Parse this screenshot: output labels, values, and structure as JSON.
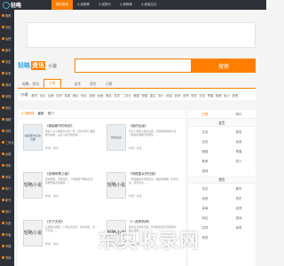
{
  "topbar": {
    "logo_text": "轻略",
    "nav": [
      "就在首页",
      "小说推荐",
      "小说排行",
      "小说榜单",
      "小说诞生记"
    ]
  },
  "sidebar": {
    "items": [
      "推荐",
      "玄幻",
      "仙侠",
      "都市",
      "历史",
      "军事",
      "游戏",
      "体育",
      "科幻",
      "悬疑",
      "灵异",
      "二次元",
      "女频",
      "书单",
      "完本",
      "热门",
      "新书",
      "排行",
      "分类",
      "作者",
      "专题",
      "书库"
    ]
  },
  "header": {
    "brand_prefix": "轻略",
    "brand_highlight": "资讯",
    "brand_sub": "小说",
    "search_placeholder": "",
    "search_button": "搜索"
  },
  "tabs": [
    "轻略 - 资讯",
    "小说",
    "女生",
    "男生",
    "订阅"
  ],
  "catbar": {
    "title": "小说",
    "categories": [
      "都市",
      "玄幻",
      "仙侠",
      "历史",
      "军事",
      "奇幻",
      "科幻",
      "游戏",
      "女频",
      "竞技",
      "灵异",
      "二次元",
      "悬疑",
      "穿越",
      "重生",
      "同人",
      "修真",
      "武侠",
      "言情",
      "现言",
      "古言",
      "青春",
      "耽美",
      "轻小",
      "其他"
    ]
  },
  "list": {
    "tabs": [
      "小说推荐",
      "最新",
      "热门"
    ],
    "books": [
      {
        "cover": "超级都市系统 封面",
        "title": "《超级都市的系统》",
        "desc": "他是个从小独自长大的少年，意外获得了超级都市系统，从此人生开始逆袭……",
        "author": "作者：佚名"
      },
      {
        "cover": "我的仙途",
        "title": "《我的仙途》",
        "desc": "平凡少年踏上修仙之路，历经磨难终成大道，一路斩妖除魔守护苍生……",
        "author": "作者：佚名"
      },
      {
        "cover": "轻略小说",
        "title": "《武魂帝尊之祖》",
        "desc": "武魂觉醒，天赋逆天，少年崛起于微末之间，誓要登临武道巅峰……",
        "author": "作者：佚名"
      },
      {
        "cover": "轻略小说",
        "title": "《帝国皇女的归途》",
        "desc": "一朝穿越成为帝国皇女，她运筹帷幄，步步为营，终登高位……",
        "author": "作者：佚名"
      },
      {
        "cover": "轻略小说",
        "title": "《天下无双》",
        "desc": "江湖风云再起，少年仗剑天涯，快意恩仇，天下无双……",
        "author": "作者：佚名"
      },
      {
        "cover": "轻略小说",
        "title": "《一品炼药师》",
        "desc": "炼药天才重生归来，凭借前世记忆丹道称尊，无人可敌……",
        "author": "作者：佚名"
      }
    ]
  },
  "rank": {
    "tabs": [
      "分类",
      "排行"
    ],
    "groups": [
      {
        "title": "女生",
        "items": [
          "古言",
          "现言",
          "幻言",
          "仙侠",
          "悬疑",
          "青春",
          "耽美",
          "同人",
          "游戏"
        ]
      },
      {
        "title": "男生",
        "items": [
          "玄幻",
          "都市",
          "仙侠",
          "历史",
          "军事",
          "武侠",
          "科幻",
          "游戏",
          "灵异",
          "体育",
          "竞技"
        ]
      }
    ]
  },
  "watermark": "东奥收录网"
}
